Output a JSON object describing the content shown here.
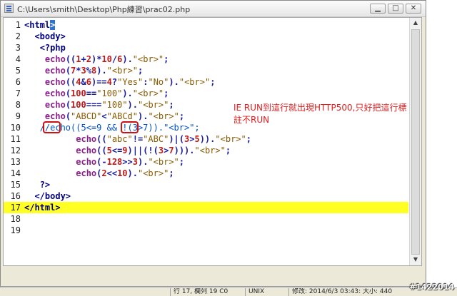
{
  "window": {
    "title": "C:\\Users\\smith\\Desktop\\Php練習\\prac02.php",
    "buttons": {
      "minimize": "▁",
      "maximize": "□",
      "close": "✕"
    }
  },
  "editor": {
    "lines": [
      {
        "n": "1",
        "tokens": [
          [
            "tag",
            "<html"
          ],
          [
            "sel",
            ">"
          ]
        ]
      },
      {
        "n": "2",
        "tokens": [
          [
            "plain",
            "  "
          ],
          [
            "tag",
            "<body>"
          ]
        ]
      },
      {
        "n": "3",
        "tokens": [
          [
            "plain",
            "   "
          ],
          [
            "tag",
            "<?php"
          ]
        ]
      },
      {
        "n": "4",
        "tokens": [
          [
            "plain",
            "    "
          ],
          [
            "kw",
            "echo"
          ],
          [
            "op",
            "(("
          ],
          [
            "num",
            "1"
          ],
          [
            "op",
            "+"
          ],
          [
            "num",
            "2"
          ],
          [
            "op",
            ")*"
          ],
          [
            "num",
            "10"
          ],
          [
            "op",
            "/"
          ],
          [
            "num",
            "6"
          ],
          [
            "op",
            ")."
          ],
          [
            "str",
            "\"<br>\""
          ],
          [
            "op",
            ";"
          ]
        ]
      },
      {
        "n": "5",
        "tokens": [
          [
            "plain",
            "    "
          ],
          [
            "kw",
            "echo"
          ],
          [
            "op",
            "("
          ],
          [
            "num",
            "7"
          ],
          [
            "op",
            "*"
          ],
          [
            "num",
            "3"
          ],
          [
            "op",
            "%"
          ],
          [
            "num",
            "8"
          ],
          [
            "op",
            ")."
          ],
          [
            "str",
            "\"<br>\""
          ],
          [
            "op",
            ";"
          ]
        ]
      },
      {
        "n": "6",
        "tokens": [
          [
            "plain",
            "    "
          ],
          [
            "kw",
            "echo"
          ],
          [
            "op",
            "(("
          ],
          [
            "num",
            "4"
          ],
          [
            "op",
            "&"
          ],
          [
            "num",
            "6"
          ],
          [
            "op",
            ")=="
          ],
          [
            "num",
            "4"
          ],
          [
            "op",
            "?"
          ],
          [
            "str",
            "\"Yes\""
          ],
          [
            "op",
            ":"
          ],
          [
            "str",
            "\"No\""
          ],
          [
            "op",
            ")."
          ],
          [
            "str",
            "\"<br>\""
          ],
          [
            "op",
            ";"
          ]
        ]
      },
      {
        "n": "7",
        "tokens": [
          [
            "plain",
            "    "
          ],
          [
            "kw",
            "echo"
          ],
          [
            "op",
            "("
          ],
          [
            "num",
            "100"
          ],
          [
            "op",
            "=="
          ],
          [
            "str",
            "\"100\""
          ],
          [
            "op",
            ")."
          ],
          [
            "str",
            "\"<br>\""
          ],
          [
            "op",
            ";"
          ]
        ]
      },
      {
        "n": "8",
        "tokens": [
          [
            "plain",
            "    "
          ],
          [
            "kw",
            "echo"
          ],
          [
            "op",
            "("
          ],
          [
            "num",
            "100"
          ],
          [
            "op",
            "==="
          ],
          [
            "str",
            "\"100\""
          ],
          [
            "op",
            ")."
          ],
          [
            "str",
            "\"<br>\""
          ],
          [
            "op",
            ";"
          ]
        ]
      },
      {
        "n": "9",
        "tokens": [
          [
            "plain",
            "    "
          ],
          [
            "kw",
            "echo"
          ],
          [
            "op",
            "("
          ],
          [
            "str",
            "\"ABCD\""
          ],
          [
            "op",
            "<"
          ],
          [
            "str",
            "\"ABCd\""
          ],
          [
            "op",
            ")."
          ],
          [
            "str",
            "\"<br>\""
          ],
          [
            "op",
            ";"
          ]
        ]
      },
      {
        "n": "10",
        "tokens": [
          [
            "plain",
            "   "
          ],
          [
            "com",
            "//echo((5<=9 && !(3>7)).\"<br>\";"
          ]
        ]
      },
      {
        "n": "11",
        "tokens": [
          [
            "plain",
            "          "
          ],
          [
            "kw",
            "echo"
          ],
          [
            "op",
            "(("
          ],
          [
            "str",
            "\"abc\""
          ],
          [
            "op",
            "!="
          ],
          [
            "str",
            "\"ABC\""
          ],
          [
            "op",
            ")|("
          ],
          [
            "num",
            "3"
          ],
          [
            "op",
            ">"
          ],
          [
            "num",
            "5"
          ],
          [
            "op",
            "))."
          ],
          [
            "str",
            "\"<br>\""
          ],
          [
            "op",
            ";"
          ]
        ]
      },
      {
        "n": "12",
        "tokens": [
          [
            "plain",
            "          "
          ],
          [
            "kw",
            "echo"
          ],
          [
            "op",
            "(("
          ],
          [
            "num",
            "5"
          ],
          [
            "op",
            "<="
          ],
          [
            "num",
            "9"
          ],
          [
            "op",
            ")||(!("
          ],
          [
            "num",
            "3"
          ],
          [
            "op",
            ">"
          ],
          [
            "num",
            "7"
          ],
          [
            "op",
            ")))."
          ],
          [
            "str",
            "\"<br>\""
          ],
          [
            "op",
            ";"
          ]
        ]
      },
      {
        "n": "13",
        "tokens": [
          [
            "plain",
            "          "
          ],
          [
            "kw",
            "echo"
          ],
          [
            "op",
            "(-"
          ],
          [
            "num",
            "128"
          ],
          [
            "op",
            ">>"
          ],
          [
            "num",
            "3"
          ],
          [
            "op",
            ")."
          ],
          [
            "str",
            "\"<br>\""
          ],
          [
            "op",
            ";"
          ]
        ]
      },
      {
        "n": "14",
        "tokens": [
          [
            "plain",
            "          "
          ],
          [
            "kw",
            "echo"
          ],
          [
            "op",
            "("
          ],
          [
            "num",
            "2"
          ],
          [
            "op",
            "<<"
          ],
          [
            "num",
            "10"
          ],
          [
            "op",
            ")."
          ],
          [
            "str",
            "\"<br>\""
          ],
          [
            "op",
            ";"
          ]
        ]
      },
      {
        "n": "15",
        "tokens": [
          [
            "plain",
            "   "
          ],
          [
            "tag",
            "?>"
          ]
        ]
      },
      {
        "n": "16",
        "tokens": [
          [
            "plain",
            "  "
          ],
          [
            "tag",
            "</body>"
          ]
        ]
      },
      {
        "n": "17",
        "tokens": [
          [
            "tag",
            "</html>"
          ]
        ]
      },
      {
        "n": "18",
        "tokens": []
      },
      {
        "n": "19",
        "tokens": []
      }
    ],
    "current_line": "17"
  },
  "annotation": {
    "line1": "IE RUN到這行就出現HTTP500,只好把這行標",
    "line2": "註不RUN"
  },
  "status": {
    "position": "行 17, 欄列 19 C0",
    "encoding": "UNIX",
    "modified": "修改: 2014/6/3 03:43: 大小: 440"
  },
  "watermark": "#1422014",
  "colors": {
    "current_line": "#ffff24",
    "annotation": "#e31d1d",
    "highlight_box": "#d01010"
  }
}
